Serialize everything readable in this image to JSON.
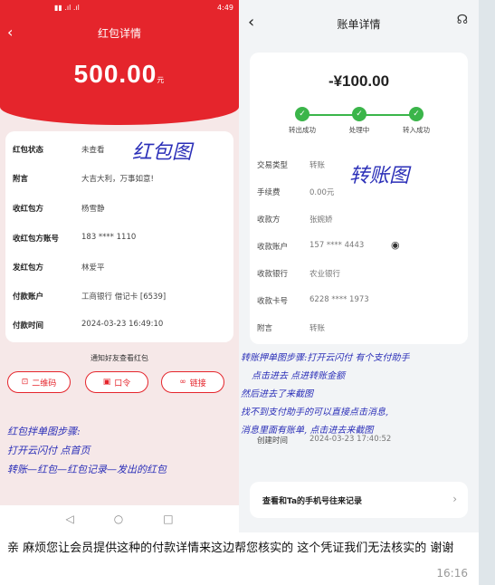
{
  "left_phone": {
    "status_time": "4:49",
    "title": "红包详情",
    "amount": "500.00",
    "amount_unit": "元",
    "rows": [
      {
        "label": "红包状态",
        "value": "未查看"
      },
      {
        "label": "附言",
        "value": "大吉大利，万事如意!"
      },
      {
        "label": "收红包方",
        "value": "杨雪静"
      },
      {
        "label": "收红包方账号",
        "value": "183 **** 1110"
      },
      {
        "label": "发红包方",
        "value": "林爱平"
      },
      {
        "label": "付款账户",
        "value": "工商银行 借记卡 [6539]"
      },
      {
        "label": "付款时间",
        "value": "2024-03-23 16:49:10"
      }
    ],
    "stamp": "红包图",
    "notice": "通知好友查看红包",
    "buttons": [
      "二维码",
      "口令",
      "链接"
    ],
    "handwritten_notes": [
      "红包拌单图步骤:",
      "打开云闪付 点首页",
      "转账—红包—红包记录—发出的红包"
    ]
  },
  "right_phone": {
    "title": "账单详情",
    "amount": "-¥100.00",
    "steps": [
      "转出成功",
      "处理中",
      "转入成功"
    ],
    "rows": [
      {
        "label": "交易类型",
        "value": "转账"
      },
      {
        "label": "手续费",
        "value": "0.00元"
      },
      {
        "label": "收款方",
        "value": "张婉娇"
      },
      {
        "label": "收款账户",
        "value": "157 **** 4443"
      },
      {
        "label": "收款银行",
        "value": "农业银行"
      },
      {
        "label": "收款卡号",
        "value": "6228 **** 1973"
      },
      {
        "label": "附言",
        "value": "转账"
      }
    ],
    "stamp": "转账图",
    "handwritten_notes": [
      "转账押单图步骤:打开云闪付 有个支付助手",
      "点击进去 点进转账金额",
      "然后进去了来截图",
      "找不到支付助手的可以直接点击消息,",
      "消息里面有账单, 点击进去来截图"
    ],
    "create_time_label": "创建时间",
    "create_time_value": "2024-03-23 17:40:52",
    "link_label": "查看和Ta的手机号往来记录"
  },
  "message": {
    "text": "亲 麻烦您让会员提供这种的付款详情来这边帮您核实的 这个凭证我们无法核实的 谢谢",
    "time": "16:16"
  }
}
